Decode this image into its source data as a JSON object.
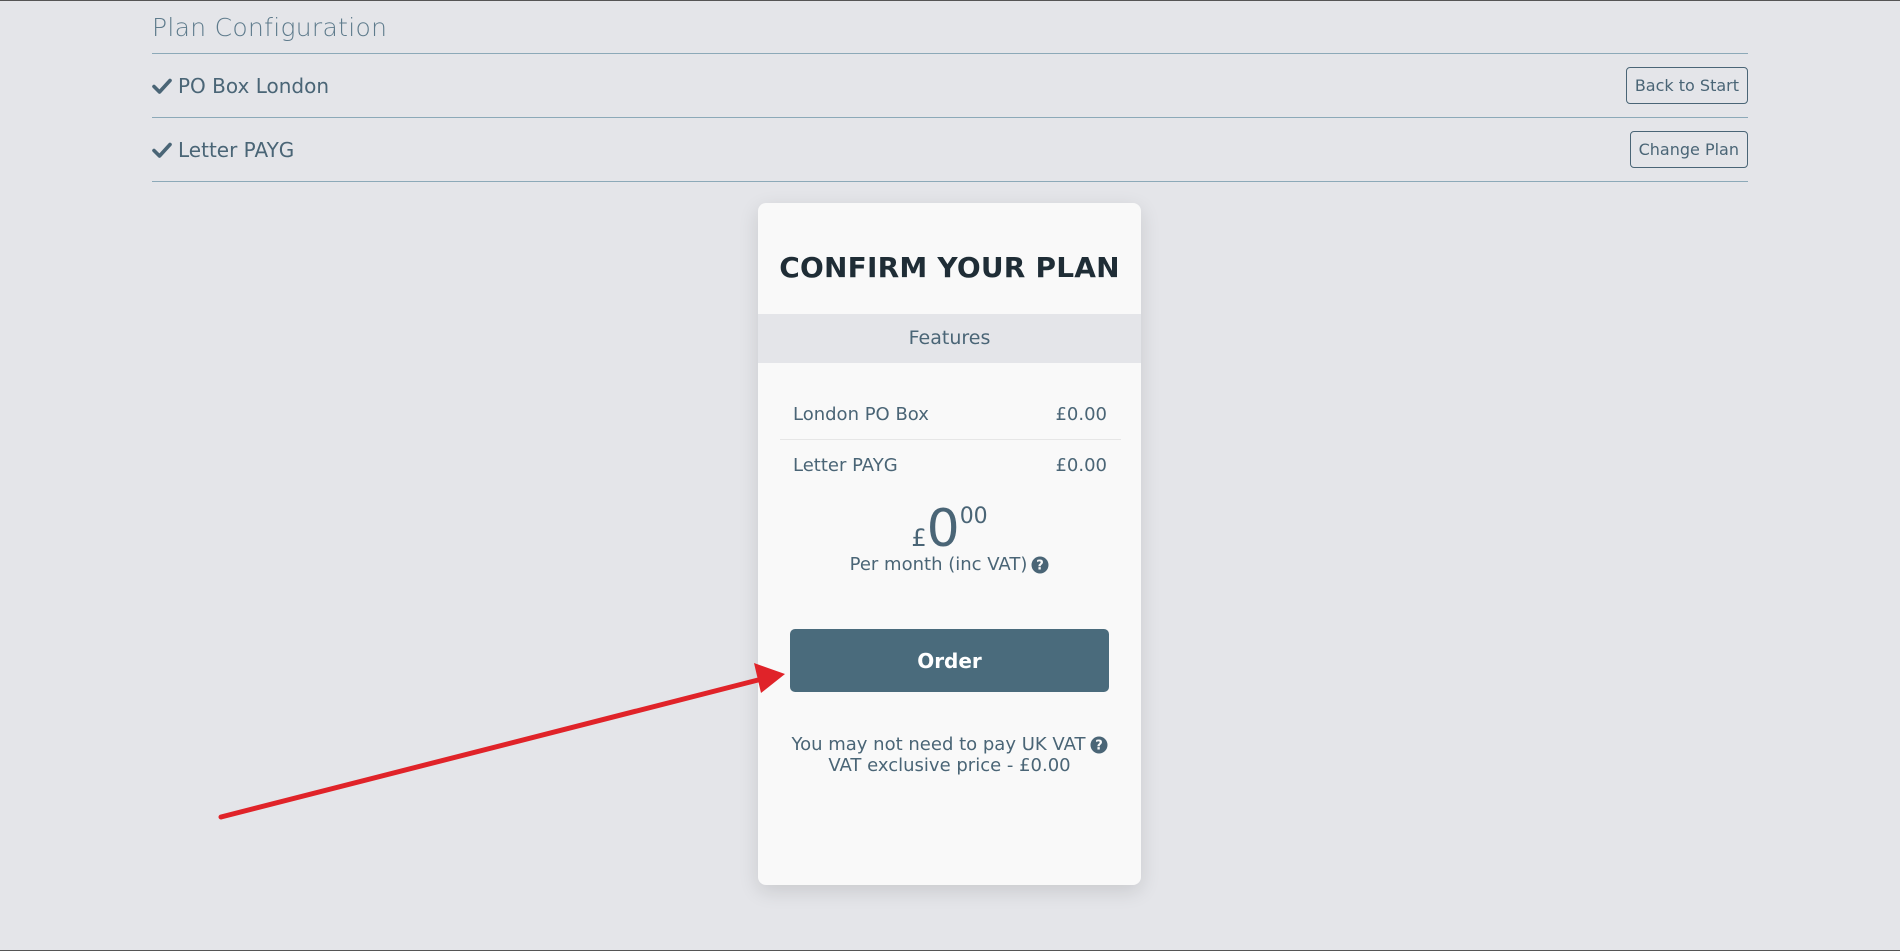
{
  "config": {
    "title": "Plan Configuration",
    "rows": [
      {
        "label": "PO Box London",
        "button": "Back to Start"
      },
      {
        "label": "Letter PAYG",
        "button": "Change Plan"
      }
    ]
  },
  "card": {
    "title": "CONFIRM YOUR PLAN",
    "features_heading": "Features",
    "features": [
      {
        "name": "London PO Box",
        "price": "£0.00"
      },
      {
        "name": "Letter PAYG",
        "price": "£0.00"
      }
    ],
    "price": {
      "currency": "£",
      "whole": "0",
      "cents": "00",
      "period": "Per month (inc VAT)"
    },
    "order_label": "Order",
    "vat_note_line1": "You may not need to pay UK VAT",
    "vat_note_line2": "VAT exclusive price - £0.00"
  },
  "colors": {
    "background": "#e4e5e9",
    "primary": "#4a6b7c",
    "text": "#4a6576",
    "annotation_arrow": "#e02329"
  },
  "icons": {
    "check": "check-icon",
    "help": "question-circle-icon",
    "annotation": "red-arrow-annotation"
  }
}
